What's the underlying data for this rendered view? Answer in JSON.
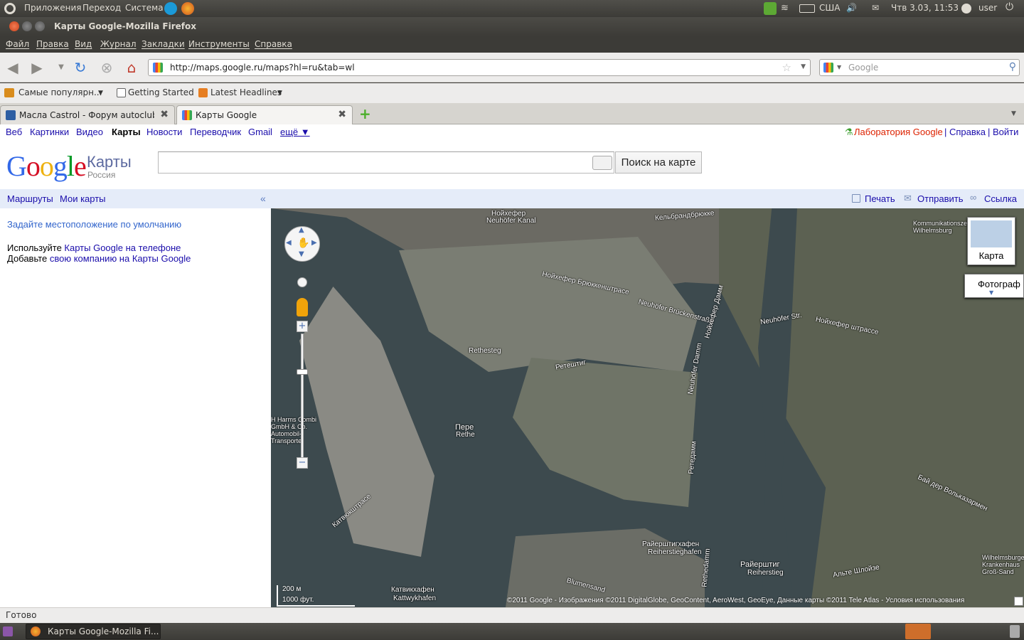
{
  "top_panel": {
    "menus": [
      "Приложения",
      "Переход",
      "Система"
    ],
    "keyboard_layout": "США",
    "datetime": "Чтв 3.03, 11:53",
    "user": "user"
  },
  "window": {
    "title": "Карты Google-Mozilla Firefox"
  },
  "menubar": [
    "Файл",
    "Правка",
    "Вид",
    "Журнал",
    "Закладки",
    "Инструменты",
    "Справка"
  ],
  "navbar": {
    "url": "http://maps.google.ru/maps?hl=ru&tab=wl",
    "search_placeholder": "Google"
  },
  "bookmarks": [
    "Самые популярн...",
    "Getting Started",
    "Latest Headlines"
  ],
  "tabs": [
    {
      "label": "Масла Castrol - Форум autoclub..."
    },
    {
      "label": "Карты Google"
    }
  ],
  "gbar": {
    "left": [
      "Веб",
      "Картинки",
      "Видео",
      "Карты",
      "Новости",
      "Переводчик",
      "Gmail",
      "ещё ▼"
    ],
    "lab": "Лаборатория Google",
    "sep": "|",
    "help": "Справка",
    "login": "Войти"
  },
  "header": {
    "logo": "Google",
    "logo_sub": "Карты",
    "logo_country": "Россия",
    "search_value": "",
    "search_button": "Поиск на карте"
  },
  "sidebar": {
    "routes": "Маршруты",
    "my_maps": "Мои карты",
    "collapse": "«",
    "set_location": "Задайте местоположение по умолчанию",
    "use_prefix": "Используйте ",
    "use_link": "Карты Google на телефоне",
    "add_prefix": "Добавьте ",
    "add_link": "свою компанию на Карты Google"
  },
  "maptoolbar": {
    "print": "Печать",
    "send": "Отправить",
    "link": "Ссылка"
  },
  "map": {
    "type_map": "Карта",
    "type_photo": "Фотограф",
    "scale_m": "200 м",
    "scale_ft": "1000 фут.",
    "copyright": "©2011 Google - Изображения ©2011 DigitalGlobe, GeoContent, AeroWest, GeoEye, Данные карты ©2011 Tele Atlas - Условия использования",
    "labels": [
      "Нойхефер",
      "Neuhöfer Kanal",
      "Пере",
      "Rethe",
      "Райерштиг",
      "Reiherstieg",
      "Райерштигхафен",
      "Reiherstieghafen",
      "Катвикхафен",
      "Kattwykhafen",
      "Нойхефер Брюккенштрасе",
      "Neuhöfer Brückenstraße",
      "Neuhöfer Str.",
      "Нойхефер штрассе",
      "Rethesteg",
      "Ретештиг",
      "Нойхефер Дамм",
      "Neuhöfer Damm",
      "Бай дер Вольказармен",
      "Ретедамм",
      "Rethedamm",
      "Blumensand",
      "Катвюкштрасе",
      "Альте Шлойзе",
      "H Harms Combi GmbH & Co. Automobil-Transporte",
      "Kommunikationszentrum Wilhelmsburg",
      "Wilhelmsburger Krankenhaus Groß-Sand",
      "Кельбрандбрюкке"
    ]
  },
  "statusbar": "Готово",
  "taskbar": {
    "window": "Карты Google-Mozilla Fi..."
  },
  "colors": {
    "panel_bg": "#3c3b37",
    "link": "#1a0dab",
    "lab": "#dd2200",
    "toolbar_bg": "#e5ecf9",
    "water": "#3d4a4e"
  }
}
